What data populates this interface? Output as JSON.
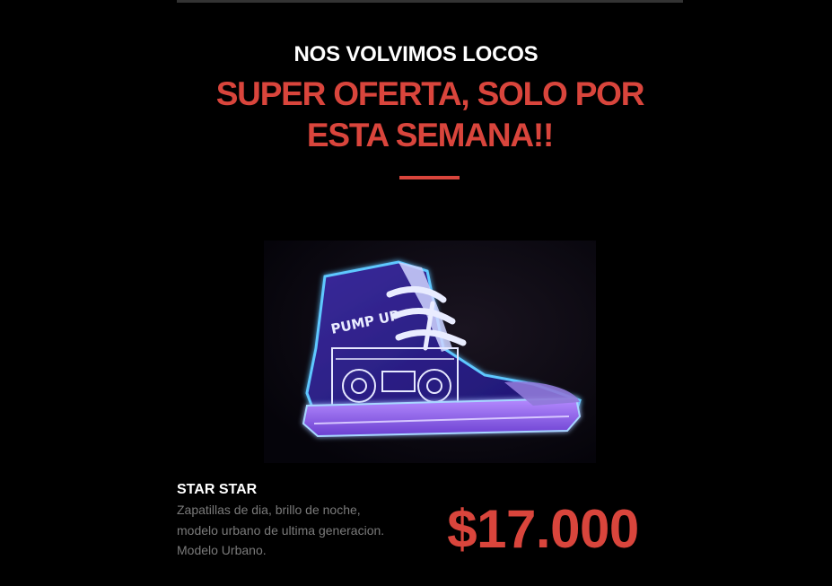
{
  "promo": {
    "kicker": "NOS VOLVIMOS LOCOS",
    "headline_line1": "SUPER OFERTA, SOLO POR",
    "headline_line2": "ESTA SEMANA!!"
  },
  "product": {
    "name": "STAR STAR",
    "description_lines": [
      "Zapatillas de dia, brillo de noche,",
      "modelo urbano de ultima generacion.",
      "Modelo Urbano."
    ],
    "price": "$17.000",
    "image_sneaker_text": "PUMP UP"
  },
  "colors": {
    "background": "#000000",
    "accent": "#d9453c",
    "heading": "#ffffff",
    "body_text": "#7a7a7a",
    "glow": "#3d6bff"
  }
}
